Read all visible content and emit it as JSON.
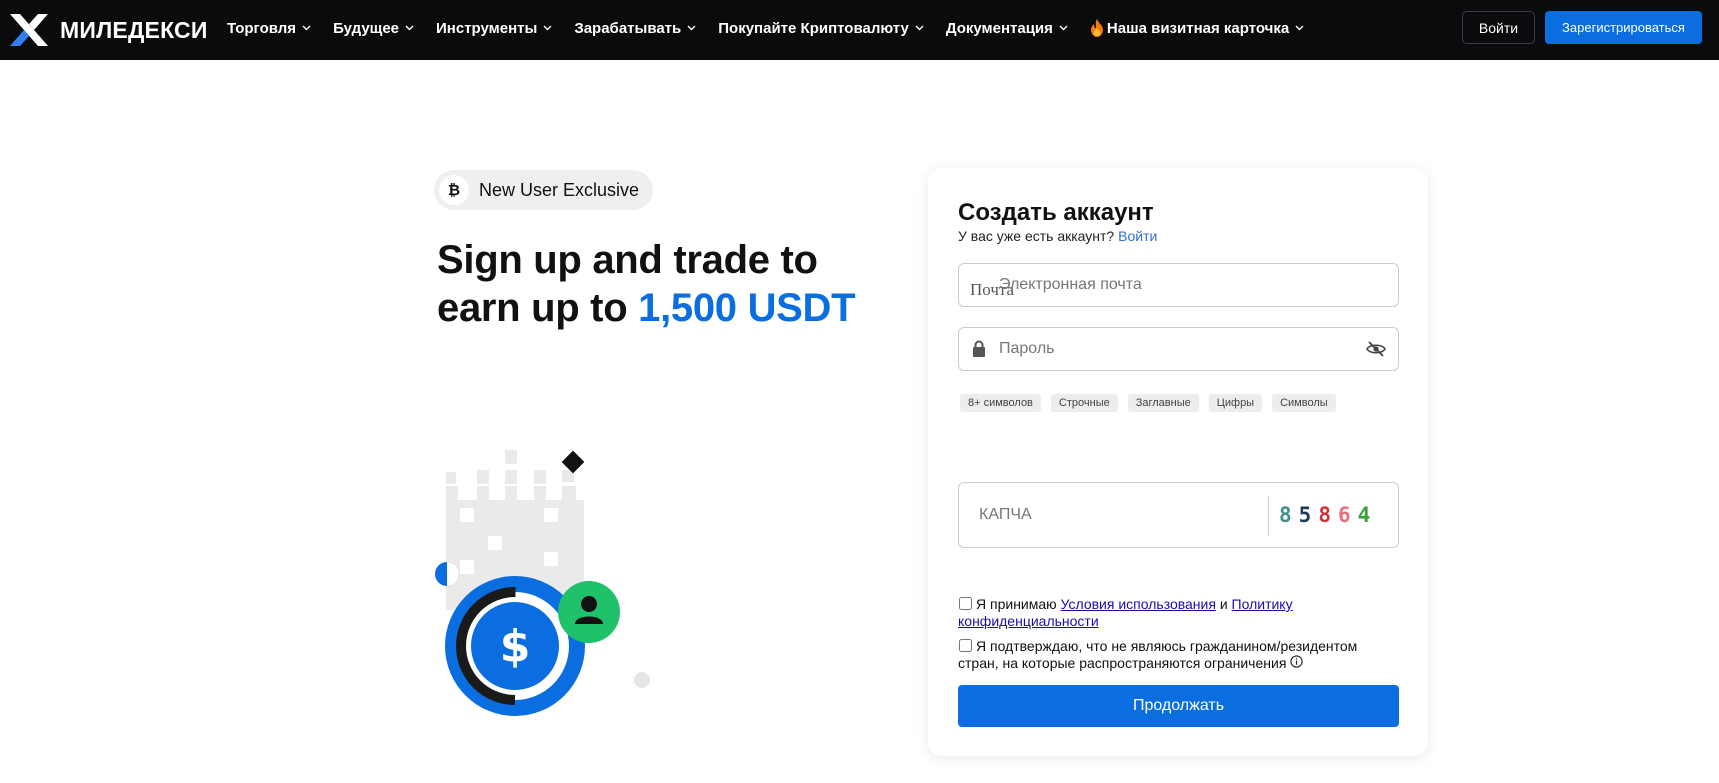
{
  "brand": {
    "name": "МИЛЕДЕКСИ",
    "accent_color": "#0a6ee0",
    "logo_icon": "x-logo-icon"
  },
  "nav": {
    "items": [
      {
        "label": "Торговля"
      },
      {
        "label": "Будущее"
      },
      {
        "label": "Инструменты"
      },
      {
        "label": "Зарабатывать"
      },
      {
        "label": "Покупайте Криптовалюту"
      },
      {
        "label": "Документация"
      },
      {
        "label": "Наша визитная карточка",
        "icon": "fire-icon"
      }
    ],
    "login_label": "Войти",
    "register_label": "Зарегистрироваться"
  },
  "promo": {
    "badge_text": "New User Exclusive",
    "badge_icon": "bitcoin-icon",
    "headline_part1": "Sign up and trade to earn up to ",
    "headline_accent": "1,500 USDT"
  },
  "signup": {
    "title": "Создать аккаунт",
    "have_account_text": "У вас уже есть аккаунт?",
    "login_link": "Войти",
    "email_label": "Почта",
    "email_placeholder": "Электронная почта",
    "password_placeholder": "Пароль",
    "password_rules": [
      "8+ символов",
      "Строчные",
      "Заглавные",
      "Цифры",
      "Символы"
    ],
    "captcha_placeholder": "КАПЧА",
    "captcha_code": [
      {
        "char": "8",
        "color": "#3b8f8f"
      },
      {
        "char": "5",
        "color": "#1f3a5a"
      },
      {
        "char": "8",
        "color": "#d0343a"
      },
      {
        "char": "6",
        "color": "#e8707a"
      },
      {
        "char": "4",
        "color": "#3aa03a"
      }
    ],
    "terms": {
      "prefix": "Я принимаю",
      "terms_link": "Условия использования",
      "conjunction": "и",
      "privacy_link": "Политику конфиденциальности"
    },
    "residency_text": "Я подтверждаю, что не являюсь гражданином/резидентом стран, на которые распространяются ограничения",
    "continue_label": "Продолжать"
  }
}
